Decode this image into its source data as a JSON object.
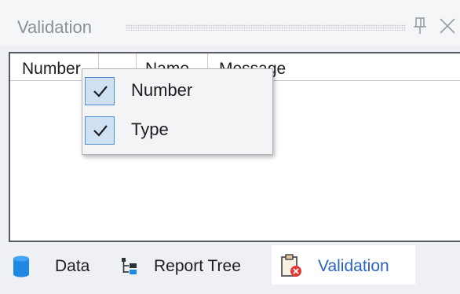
{
  "panel": {
    "title": "Validation"
  },
  "grid": {
    "columns": [
      {
        "label": "Number"
      },
      {
        "label": "Name"
      },
      {
        "label": "Message"
      }
    ]
  },
  "context_menu": {
    "items": [
      {
        "label": "Number",
        "checked": true
      },
      {
        "label": "Type",
        "checked": true
      }
    ]
  },
  "tabs": [
    {
      "label": "Data",
      "icon": "database-icon",
      "active": false
    },
    {
      "label": "Report Tree",
      "icon": "tree-icon",
      "active": false
    },
    {
      "label": "Validation",
      "icon": "clipboard-error-icon",
      "active": true
    }
  ],
  "colors": {
    "active_tab_text": "#2a63c3",
    "check_bg": "#cfe1f3",
    "check_border": "#4c8fd0",
    "database_blue": "#1e88e5",
    "error_red": "#e53935"
  }
}
